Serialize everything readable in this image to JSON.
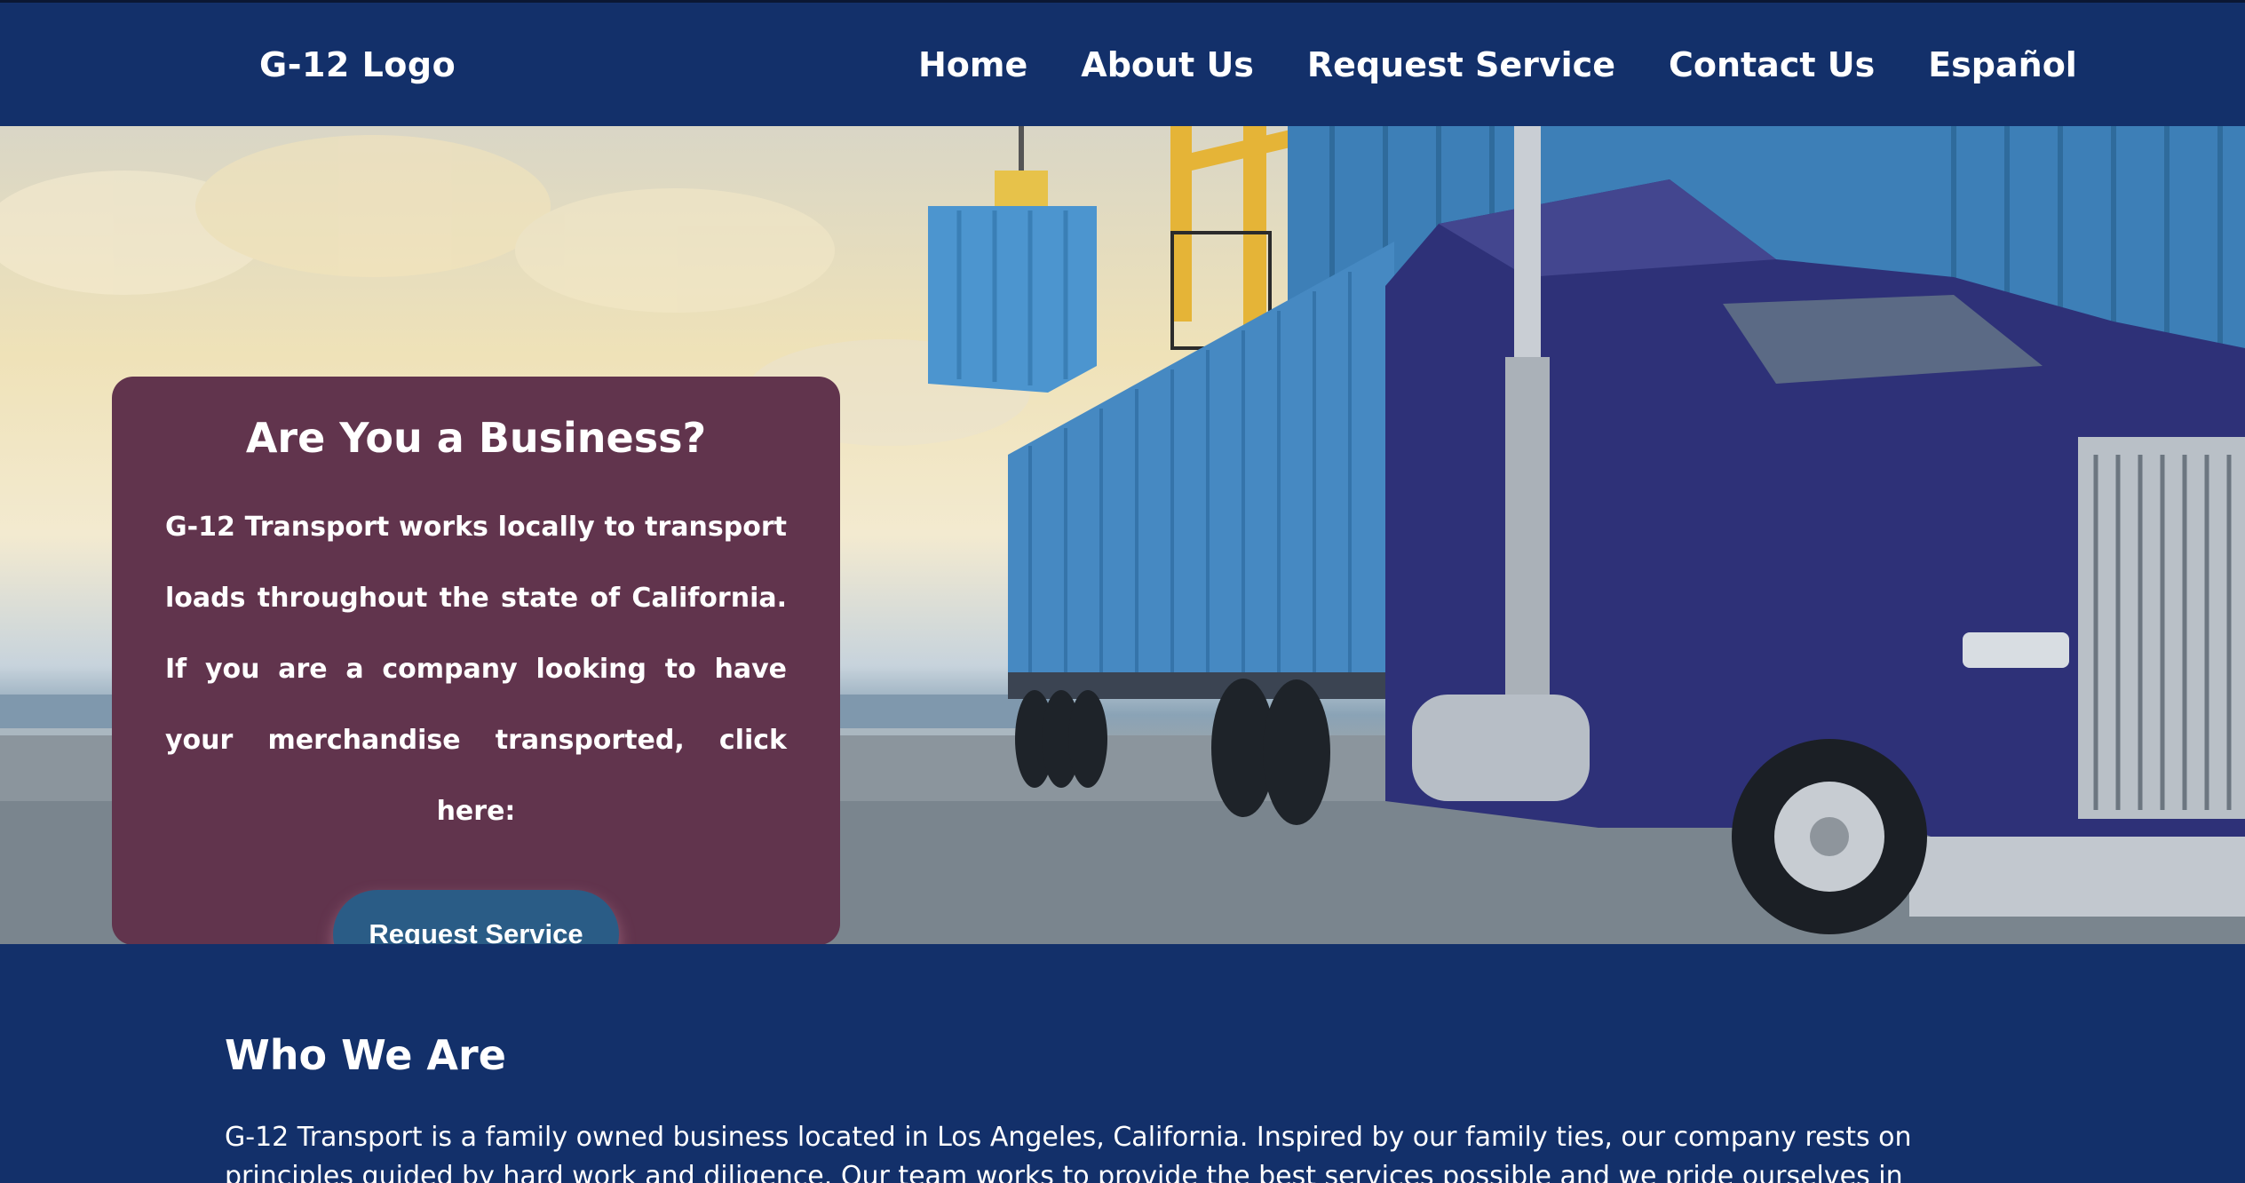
{
  "header": {
    "logo": "G-12 Logo",
    "nav": [
      "Home",
      "About Us",
      "Request Service",
      "Contact Us",
      "Español"
    ]
  },
  "hero": {
    "card": {
      "title": "Are You a Business?",
      "body": "G-12 Transport works locally to transport loads throughout the state of California. If you are a company looking to have your merchandise transported, click here:",
      "button": "Request Service"
    },
    "image_icon": "truck-and-container-image"
  },
  "about": {
    "title": "Who We Are",
    "text": "G-12 Transport is a family owned business located in Los Angeles, California. Inspired by our family ties, our company rests on principles guided by hard work and diligence. Our team works to provide the best services possible and we pride ourselves in meeting"
  },
  "colors": {
    "navy": "#13306a",
    "card": "#61344d",
    "button": "#2a5c86"
  }
}
